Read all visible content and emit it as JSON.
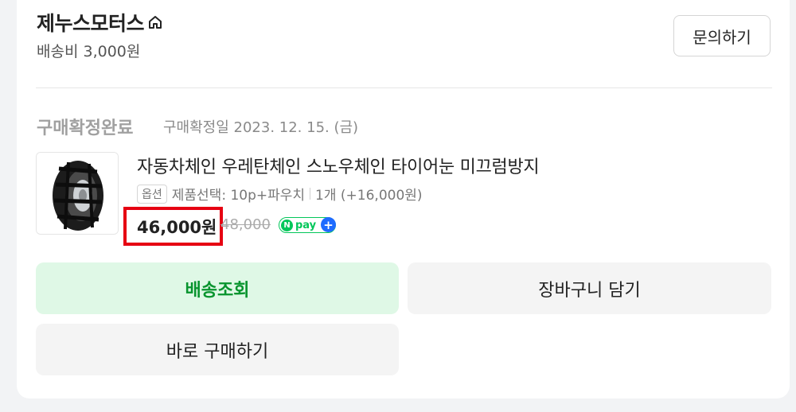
{
  "store": {
    "name": "제누스모터스",
    "shipping_fee": "배송비 3,000원",
    "inquiry_label": "문의하기"
  },
  "order": {
    "status": "구매확정완료",
    "confirm_date": "구매확정일 2023. 12. 15. (금)"
  },
  "product": {
    "name": "자동차체인 우레탄체인 스노우체인 타이어눈 미끄럼방지",
    "option_tag": "옵션",
    "option_text": "제품선택: 10p+파우치",
    "quantity_text": "1개 (+16,000원)",
    "price": "46,000원",
    "original_price": "48,000",
    "npay_text": "pay"
  },
  "buttons": {
    "track": "배송조회",
    "cart": "장바구니 담기",
    "buy": "바로 구매하기"
  },
  "colors": {
    "highlight": "#e60012",
    "track_bg": "#dff8e6",
    "track_text": "#08942e",
    "npay_green": "#03c75a"
  }
}
